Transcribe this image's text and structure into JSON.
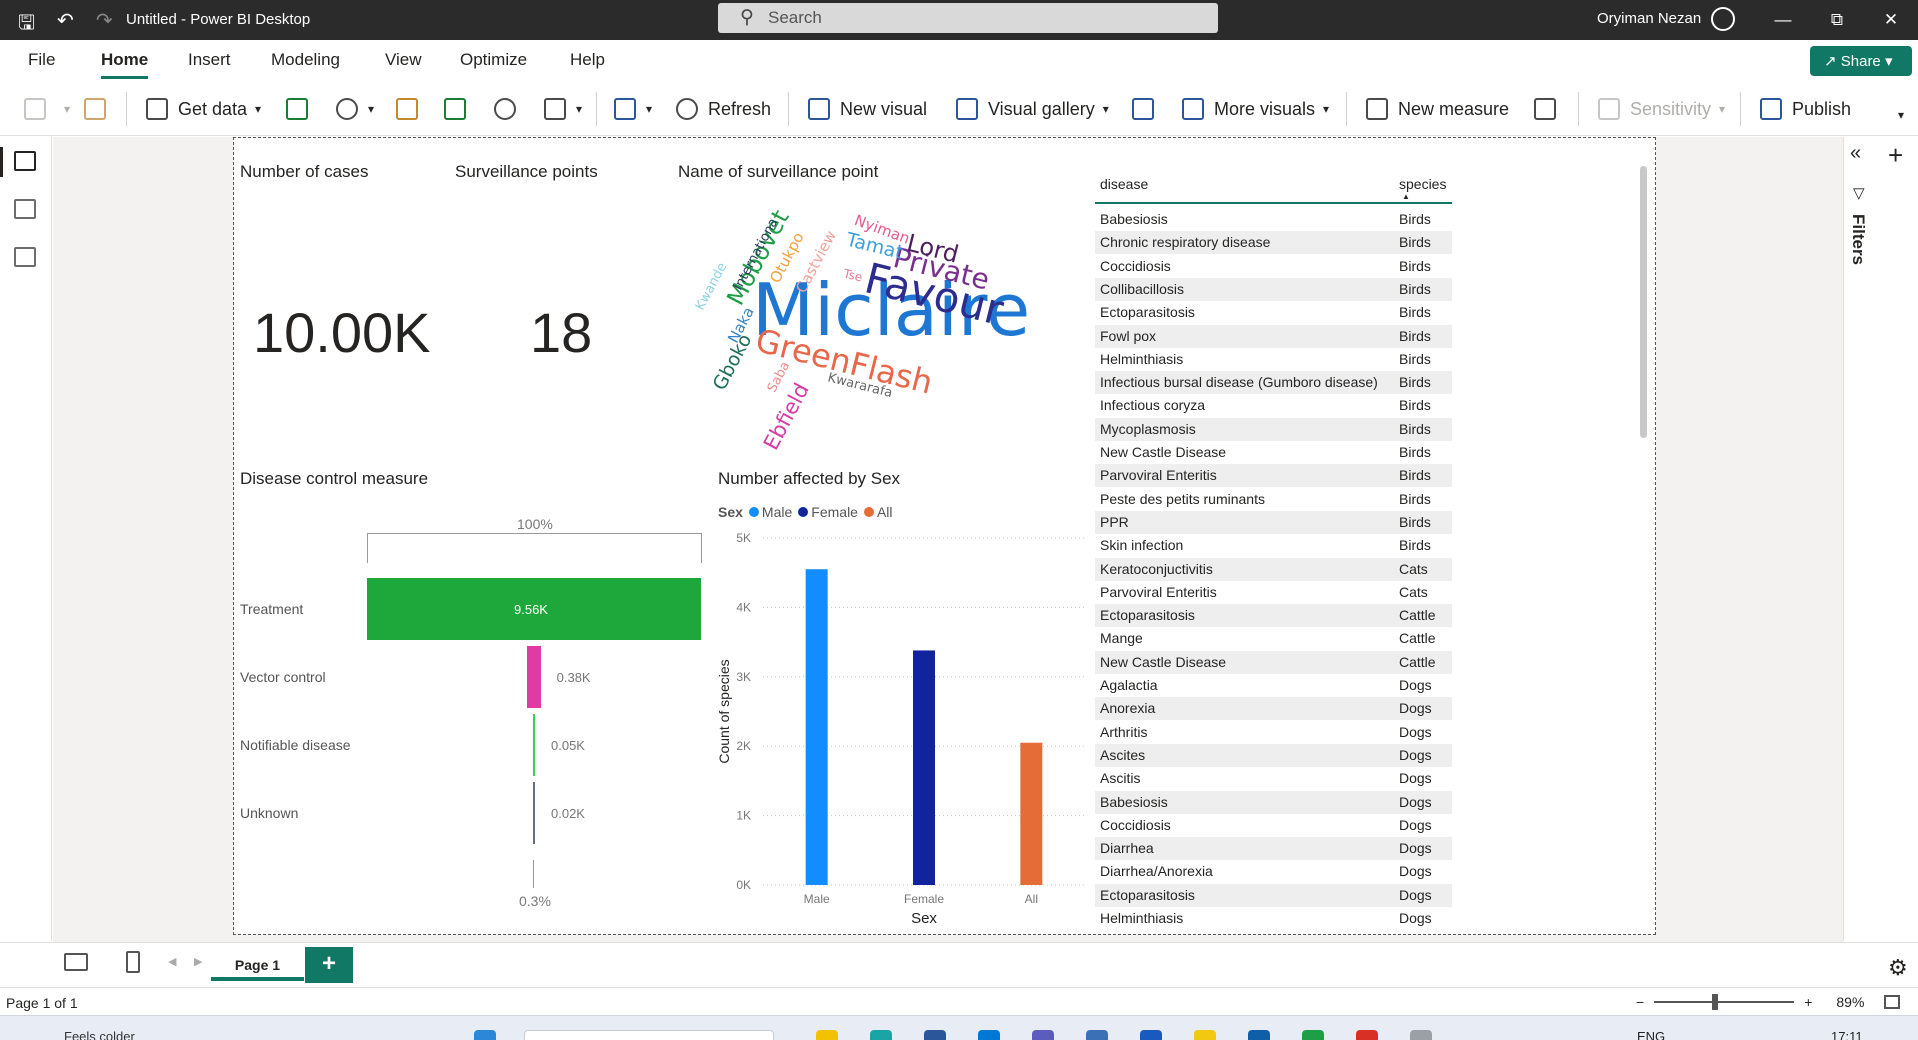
{
  "window": {
    "title": "Untitled - Power BI Desktop",
    "search_placeholder": "Search",
    "user": "Oryiman Nezan"
  },
  "menu": {
    "tabs": [
      "File",
      "Home",
      "Insert",
      "Modeling",
      "View",
      "Optimize",
      "Help"
    ],
    "active": "Home",
    "share_label": "Share"
  },
  "ribbon": {
    "get_data": "Get data",
    "refresh": "Refresh",
    "new_visual": "New visual",
    "visual_gallery": "Visual gallery",
    "more_visuals": "More visuals",
    "new_measure": "New measure",
    "sensitivity": "Sensitivity",
    "publish": "Publish"
  },
  "cards": {
    "cases_title": "Number of cases",
    "cases_value": "10.00K",
    "points_title": "Surveillance points",
    "points_value": "18",
    "wordcloud_title": "Name of surveillance point"
  },
  "wordcloud": [
    {
      "text": "Miclaire",
      "color": "#1f77d4"
    },
    {
      "text": "Favour",
      "color": "#2d2d8f"
    },
    {
      "text": "Private",
      "color": "#7b2d8f"
    },
    {
      "text": "Lord",
      "color": "#4b1f5e"
    },
    {
      "text": "GreenFlash",
      "color": "#e8664a"
    },
    {
      "text": "Mobovet",
      "color": "#1e9e47"
    },
    {
      "text": "Tamat",
      "color": "#3fa0d8"
    },
    {
      "text": "Nyiman",
      "color": "#e55b8c"
    },
    {
      "text": "Otukpo",
      "color": "#f2a03d"
    },
    {
      "text": "Castview",
      "color": "#f4a09a"
    },
    {
      "text": "Internationa",
      "color": "#2a3c5e"
    },
    {
      "text": "Kwande",
      "color": "#8fd3e8"
    },
    {
      "text": "Naka",
      "color": "#3a84c4"
    },
    {
      "text": "Gboko",
      "color": "#1e6e5a"
    },
    {
      "text": "Saba",
      "color": "#f08c8c"
    },
    {
      "text": "Ebfield",
      "color": "#d63ba8"
    },
    {
      "text": "Kwararafa",
      "color": "#666666"
    },
    {
      "text": "Tse",
      "color": "#e07890"
    }
  ],
  "funnel": {
    "title": "Disease control measure",
    "top_pct": "100%",
    "bottom_pct": "0.3%",
    "stages": [
      {
        "label": "Treatment",
        "value": 9.56,
        "display": "9.56K",
        "color": "#1ea83c"
      },
      {
        "label": "Vector control",
        "value": 0.38,
        "display": "0.38K",
        "color": "#e03ba5"
      },
      {
        "label": "Notifiable disease",
        "value": 0.05,
        "display": "0.05K",
        "color": "#3bd05a"
      },
      {
        "label": "Unknown",
        "value": 0.02,
        "display": "0.02K",
        "color": "#607080"
      }
    ]
  },
  "chart_data": {
    "type": "bar",
    "title": "Number affected by Sex",
    "legend_title": "Sex",
    "xlabel": "Sex",
    "ylabel": "Count of species",
    "categories": [
      "Male",
      "Female",
      "All"
    ],
    "values": [
      4550,
      3380,
      2050
    ],
    "colors": [
      "#118dff",
      "#12239e",
      "#e66c37"
    ],
    "yticks": [
      "0K",
      "1K",
      "2K",
      "3K",
      "4K",
      "5K"
    ],
    "ylim": [
      0,
      5000
    ],
    "legend": [
      "Male",
      "Female",
      "All"
    ],
    "grid": true
  },
  "table": {
    "headers": [
      "disease",
      "species"
    ],
    "rows": [
      [
        "Babesiosis",
        "Birds"
      ],
      [
        "Chronic respiratory disease",
        "Birds"
      ],
      [
        "Coccidiosis",
        "Birds"
      ],
      [
        "Collibacillosis",
        "Birds"
      ],
      [
        "Ectoparasitosis",
        "Birds"
      ],
      [
        "Fowl pox",
        "Birds"
      ],
      [
        "Helminthiasis",
        "Birds"
      ],
      [
        "Infectious bursal disease (Gumboro disease)",
        "Birds"
      ],
      [
        "Infectious coryza",
        "Birds"
      ],
      [
        "Mycoplasmosis",
        "Birds"
      ],
      [
        "New Castle Disease",
        "Birds"
      ],
      [
        "Parvoviral Enteritis",
        "Birds"
      ],
      [
        "Peste des petits ruminants",
        "Birds"
      ],
      [
        "PPR",
        "Birds"
      ],
      [
        "Skin infection",
        "Birds"
      ],
      [
        "Keratoconjuctivitis",
        "Cats"
      ],
      [
        "Parvoviral Enteritis",
        "Cats"
      ],
      [
        "Ectoparasitosis",
        "Cattle"
      ],
      [
        "Mange",
        "Cattle"
      ],
      [
        "New Castle Disease",
        "Cattle"
      ],
      [
        "Agalactia",
        "Dogs"
      ],
      [
        "Anorexia",
        "Dogs"
      ],
      [
        "Arthritis",
        "Dogs"
      ],
      [
        "Ascites",
        "Dogs"
      ],
      [
        "Ascitis",
        "Dogs"
      ],
      [
        "Babesiosis",
        "Dogs"
      ],
      [
        "Coccidiosis",
        "Dogs"
      ],
      [
        "Diarrhea",
        "Dogs"
      ],
      [
        "Diarrhea/Anorexia",
        "Dogs"
      ],
      [
        "Ectoparasitosis",
        "Dogs"
      ],
      [
        "Helminthiasis",
        "Dogs"
      ]
    ]
  },
  "filters_label": "Filters",
  "pages": {
    "current": "Page 1",
    "add": "+"
  },
  "status": {
    "page_info": "Page 1 of 1",
    "zoom": "89%"
  },
  "taskbar": {
    "weather": "Feels colder",
    "lang": "ENG",
    "time": "17:11"
  }
}
